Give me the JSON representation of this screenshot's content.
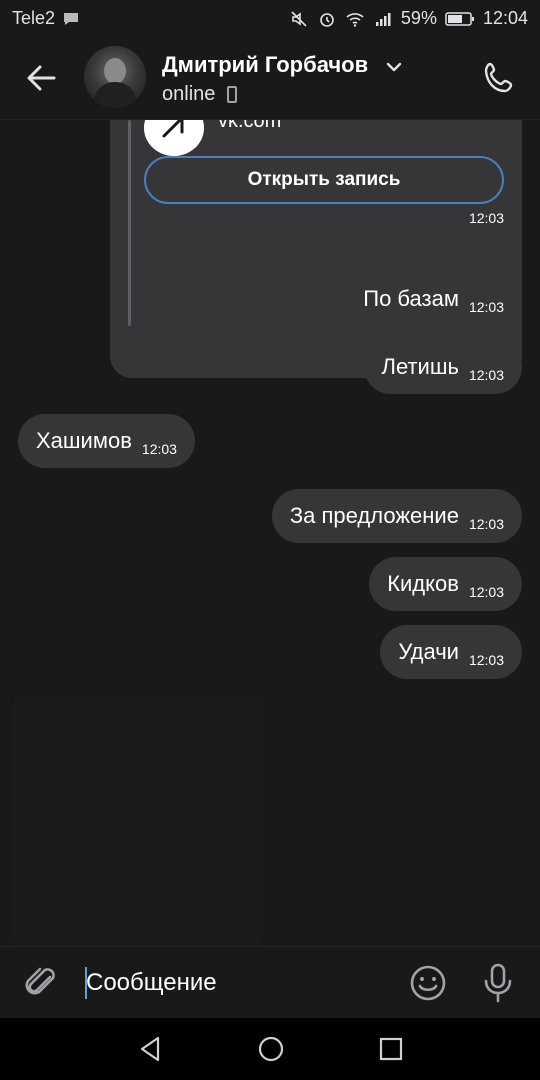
{
  "status_bar": {
    "carrier": "Tele2",
    "battery": "59%",
    "time": "12:04",
    "icons": [
      "message-bubble-icon",
      "mute-icon",
      "alarm-icon",
      "wifi-icon",
      "signal-icon",
      "battery-icon"
    ]
  },
  "header": {
    "contact_name": "Дмитрий Горбачов",
    "status": "online",
    "icons": [
      "back-arrow-icon",
      "chevron-down-icon",
      "mobile-device-icon",
      "phone-icon"
    ]
  },
  "link_attachment": {
    "domain": "vk.com",
    "button_label": "Открыть запись",
    "time": "12:03"
  },
  "messages": [
    {
      "direction": "out",
      "text": "По базам",
      "time": "12:03"
    },
    {
      "direction": "out",
      "text": "Летишь",
      "time": "12:03"
    },
    {
      "direction": "in",
      "text": "Хашимов",
      "time": "12:03"
    },
    {
      "direction": "out",
      "text": "За предложение",
      "time": "12:03"
    },
    {
      "direction": "out",
      "text": "Кидков",
      "time": "12:03"
    },
    {
      "direction": "out",
      "text": "Удачи",
      "time": "12:03"
    }
  ],
  "composer": {
    "placeholder": "Сообщение",
    "icons": [
      "paperclip-icon",
      "emoji-icon",
      "microphone-icon"
    ]
  },
  "nav_bar": {
    "icons": [
      "nav-back-icon",
      "nav-home-icon",
      "nav-recent-icon"
    ]
  },
  "colors": {
    "background": "#19191a",
    "bubble": "#363638",
    "accent": "#4a7fb8",
    "text": "#ffffff"
  }
}
